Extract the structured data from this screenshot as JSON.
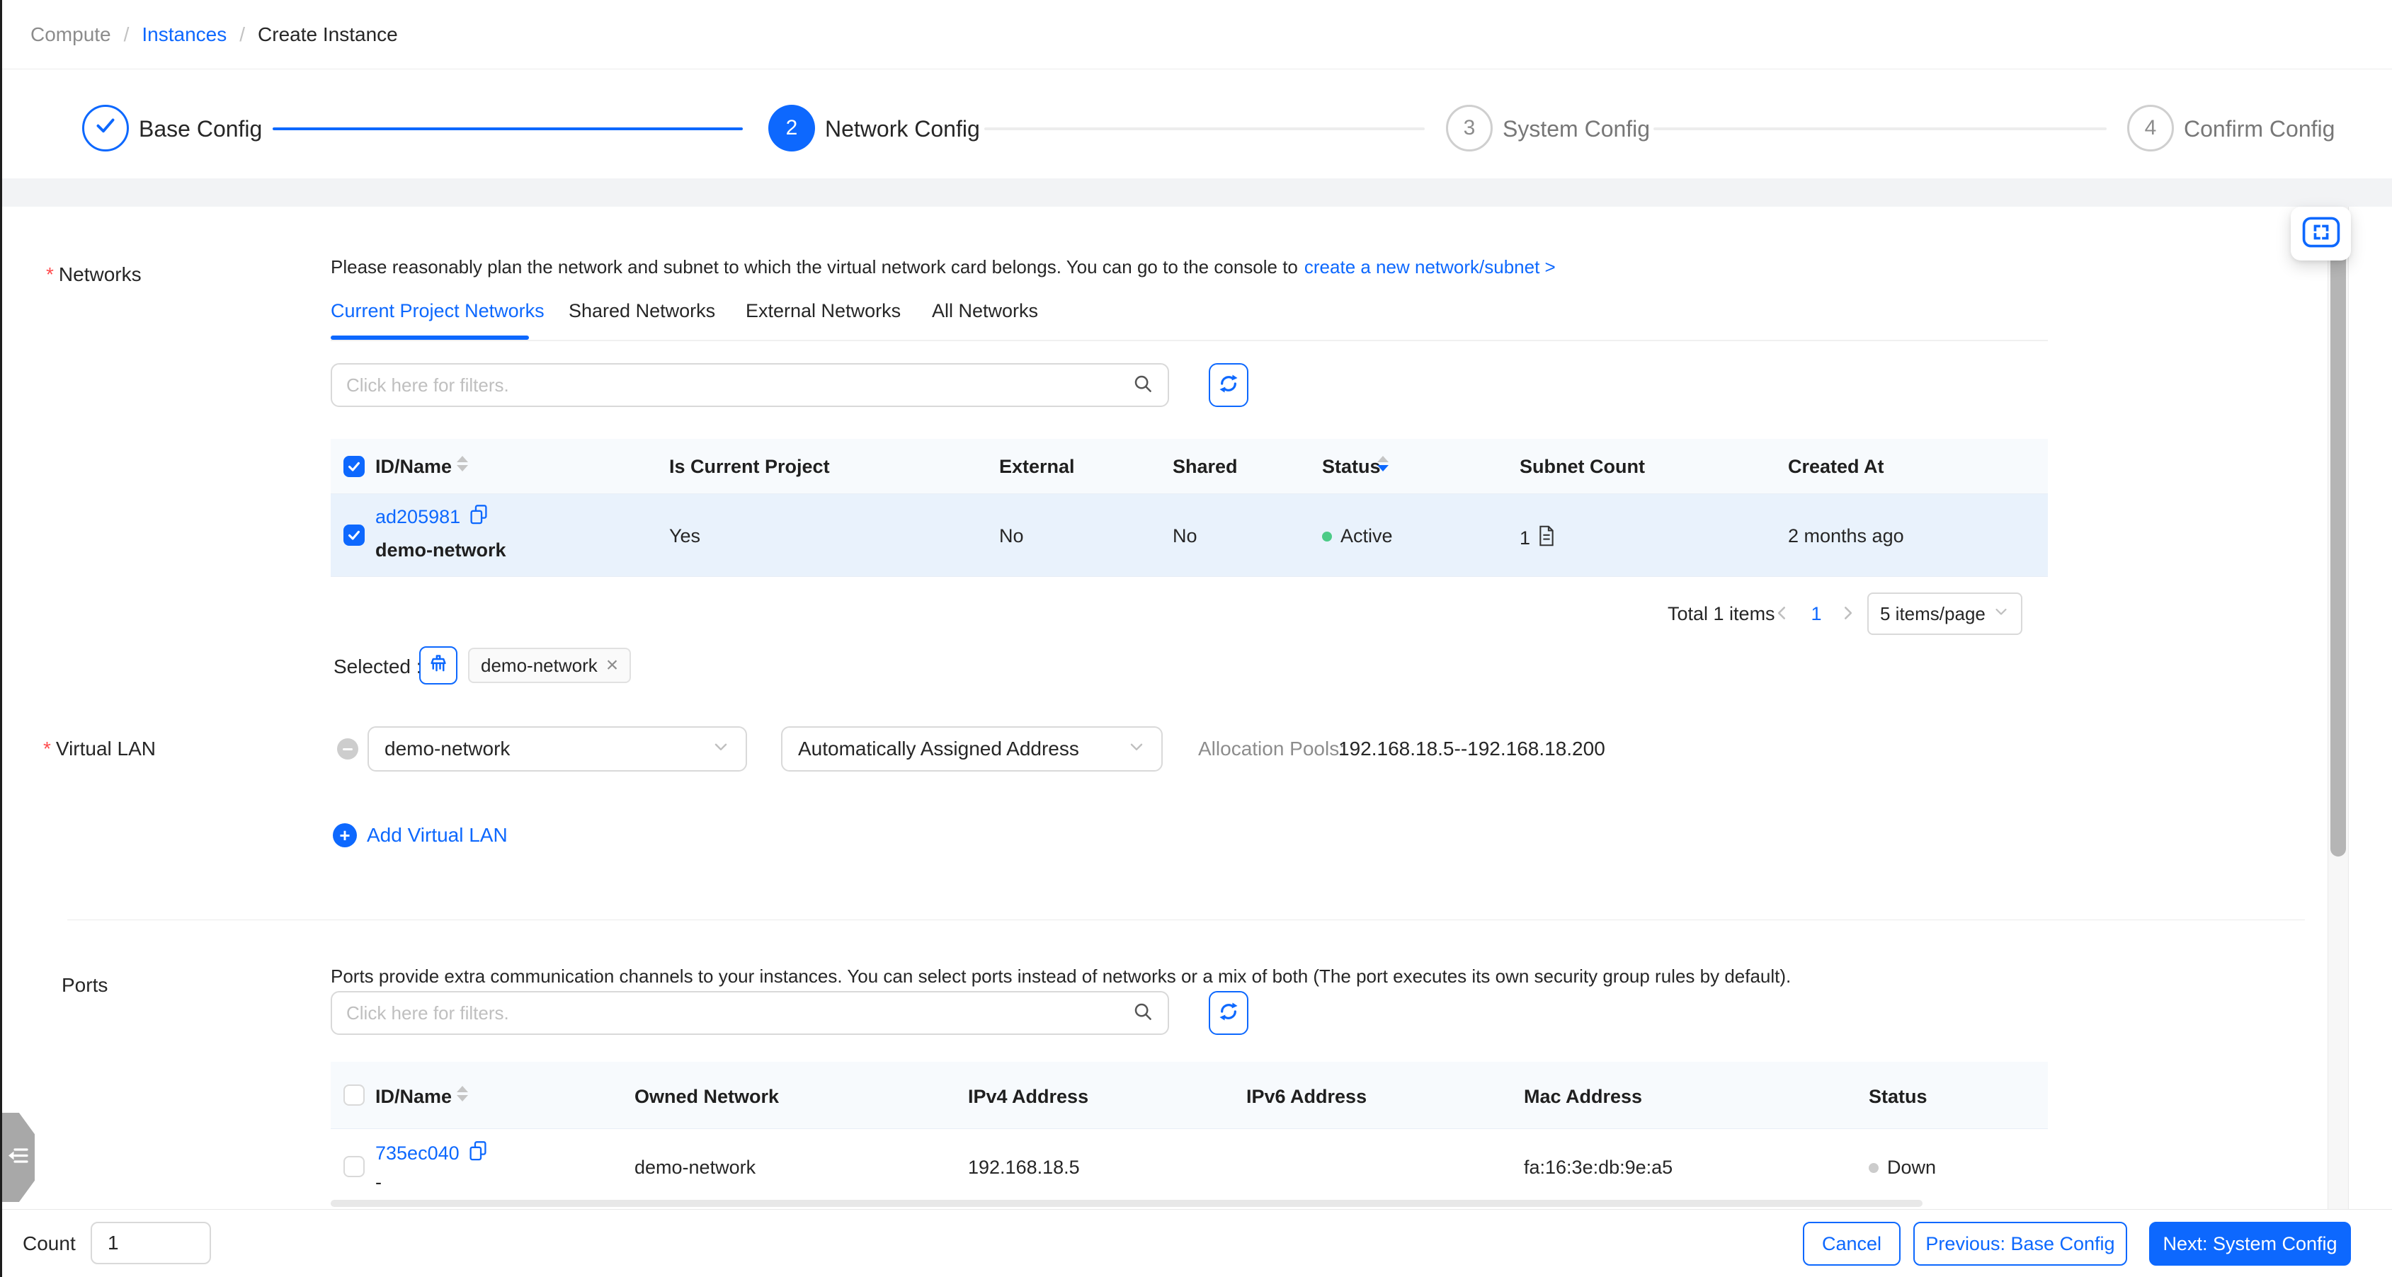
{
  "breadcrumb": {
    "items": [
      "Compute",
      "Instances",
      "Create Instance"
    ],
    "separator": "/"
  },
  "steps": [
    {
      "num": "1",
      "label": "Base Config",
      "state": "done"
    },
    {
      "num": "2",
      "label": "Network Config",
      "state": "active"
    },
    {
      "num": "3",
      "label": "System Config",
      "state": "pending"
    },
    {
      "num": "4",
      "label": "Confirm Config",
      "state": "pending"
    }
  ],
  "networks": {
    "field_label": "Networks",
    "hint_text": "Please reasonably plan the network and subnet to which the virtual network card belongs. You can go to the console to",
    "hint_link": "create a new network/subnet >",
    "tabs": [
      "Current Project Networks",
      "Shared Networks",
      "External Networks",
      "All Networks"
    ],
    "active_tab": "Current Project Networks",
    "filter_placeholder": "Click here for filters.",
    "columns": [
      "ID/Name",
      "Is Current Project",
      "External",
      "Shared",
      "Status",
      "Subnet Count",
      "Created At"
    ],
    "row": {
      "id": "ad205981",
      "name": "demo-network",
      "is_current_project": "Yes",
      "external": "No",
      "shared": "No",
      "status": "Active",
      "subnet_count": "1",
      "created_at": "2 months ago"
    },
    "pagination": {
      "total": "Total 1 items",
      "current_page": "1",
      "page_size": "5 items/page"
    },
    "selected_label": "Selected :",
    "selected_tag": "demo-network"
  },
  "virtual_lan": {
    "field_label": "Virtual LAN",
    "network": "demo-network",
    "address_mode": "Automatically Assigned Address",
    "allocation_label": "Allocation Pools:",
    "allocation_range": "192.168.18.5--192.168.18.200",
    "add_button": "Add Virtual LAN"
  },
  "ports": {
    "field_label": "Ports",
    "hint": "Ports provide extra communication channels to your instances. You can select ports instead of networks or a mix of both (The port executes its own security group rules by default).",
    "filter_placeholder": "Click here for filters.",
    "columns": [
      "ID/Name",
      "Owned Network",
      "IPv4 Address",
      "IPv6 Address",
      "Mac Address",
      "Status"
    ],
    "row": {
      "id": "735ec040",
      "name": "-",
      "owned_network": "demo-network",
      "ipv4": "192.168.18.5",
      "ipv6": "",
      "mac": "fa:16:3e:db:9e:a5",
      "status": "Down"
    }
  },
  "footer": {
    "count_label": "Count",
    "count_value": "1",
    "cancel": "Cancel",
    "previous": "Previous: Base Config",
    "next": "Next: System Config"
  },
  "colors": {
    "accent": "#0d68fe",
    "status_active": "#4ccb87",
    "status_down": "#cccccc"
  }
}
